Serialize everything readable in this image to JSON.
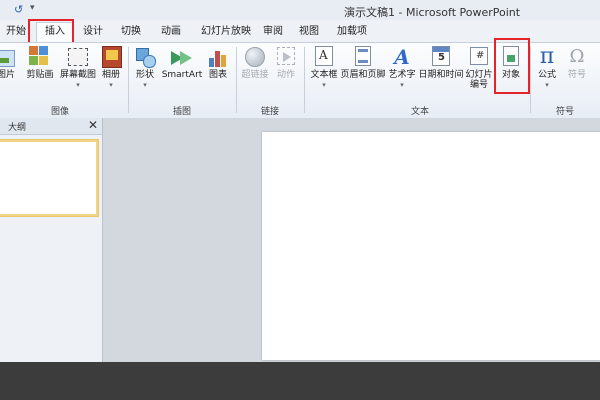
{
  "window": {
    "title": "演示文稿1 - Microsoft PowerPoint",
    "quick_access": {
      "undo_glyph": "↺",
      "customize_glyph": "▾"
    }
  },
  "tabs": [
    {
      "label": "开始"
    },
    {
      "label": "插入",
      "active": true,
      "highlighted": true
    },
    {
      "label": "设计"
    },
    {
      "label": "切换"
    },
    {
      "label": "动画"
    },
    {
      "label": "幻灯片放映"
    },
    {
      "label": "审阅"
    },
    {
      "label": "视图"
    },
    {
      "label": "加载项"
    }
  ],
  "ribbon": {
    "groups": {
      "images": "图像",
      "illustrations": "插图",
      "links": "链接",
      "text": "文本",
      "symbols": "符号"
    },
    "buttons": {
      "picture": "图片",
      "clipart": "剪贴画",
      "screenshot": "屏幕截图",
      "album": "相册",
      "shapes": "形状",
      "smartart": "SmartArt",
      "chart": "图表",
      "hyperlink": "超链接",
      "action": "动作",
      "textbox": "文本框",
      "header_footer": "页眉和页脚",
      "wordart": "艺术字",
      "datetime": "日期和时间",
      "slide_number_line1": "幻灯片",
      "slide_number_line2": "编号",
      "object": "对象",
      "equation": "公式",
      "symbol": "符号"
    },
    "dropdown_glyph": "▾"
  },
  "left_panel": {
    "tab_label": "大纲",
    "close_glyph": "✕"
  },
  "colors": {
    "highlight_box": "#e3242b",
    "bottom_bar": "#3c3c3c"
  },
  "icons": {
    "picture": "picture-icon",
    "clipart": "clipart-icon",
    "screenshot": "screenshot-icon",
    "album": "photo-album-icon",
    "shapes": "shapes-icon",
    "smartart": "smartart-icon",
    "chart": "chart-icon",
    "hyperlink": "globe-icon",
    "action": "action-icon",
    "textbox": "textbox-icon",
    "header_footer": "header-footer-icon",
    "wordart": "wordart-icon",
    "datetime": "calendar-icon",
    "slide_number": "slide-number-icon",
    "object": "object-icon",
    "equation": "pi-icon",
    "symbol": "omega-icon"
  }
}
